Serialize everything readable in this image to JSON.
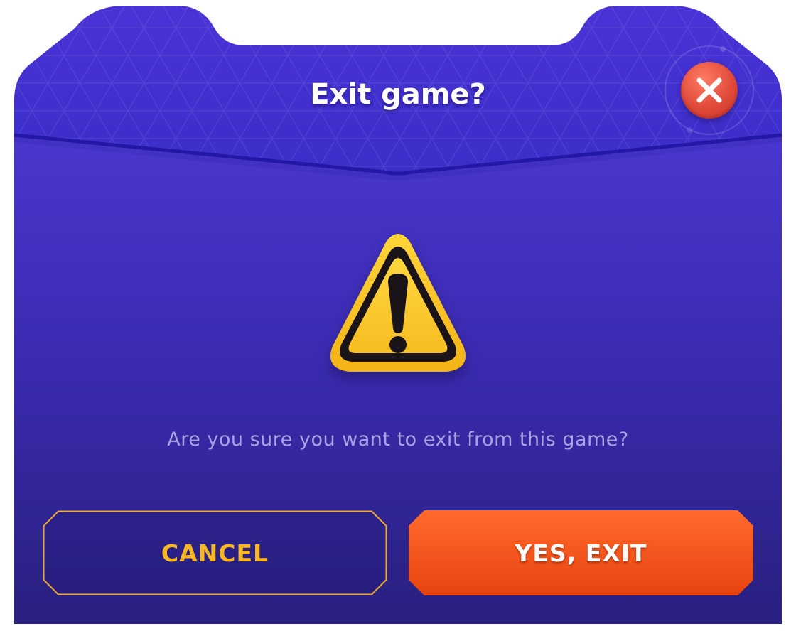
{
  "dialog": {
    "title": "Exit game?",
    "message": "Are you sure you want to exit from this game?"
  },
  "buttons": {
    "cancel_label": "CANCEL",
    "exit_label": "YES, EXIT"
  },
  "icons": {
    "close": "close-icon",
    "warning": "warning-icon"
  },
  "colors": {
    "panel_top": "#4a36cf",
    "panel_bottom": "#2a1f85",
    "accent_yellow": "#f8b622",
    "accent_orange": "#f45a1f",
    "close_red": "#e04a3a"
  }
}
